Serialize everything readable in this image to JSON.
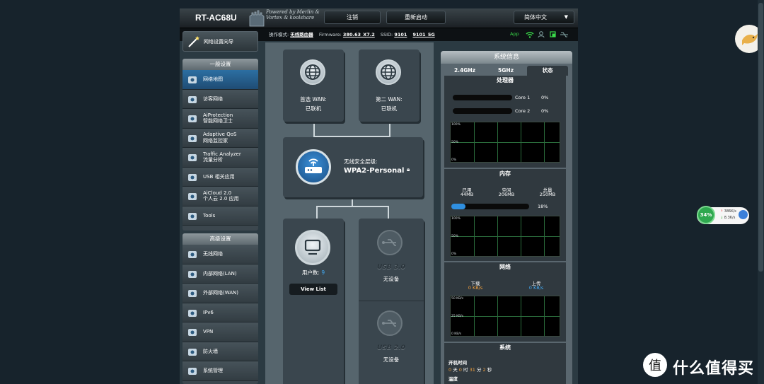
{
  "header": {
    "model": "RT-AC68U",
    "logo_text": "Powered by Merlin & Vortex & koolshare",
    "logout": "注销",
    "reboot": "重新启动",
    "language": "简体中文"
  },
  "status_line": {
    "mode_label": "操作模式:",
    "mode_value": "无线路由器",
    "fw_label": "Firmware:",
    "fw_value": "380.63_X7.2",
    "ssid_label": "SSID:",
    "ssid1": "9101",
    "ssid2": "9101_5G",
    "app": "App"
  },
  "sidebar": {
    "qis": "网络设置向导",
    "general_head": "一般设置",
    "general": [
      {
        "label": "网络地图",
        "icon": "network-map-icon"
      },
      {
        "label": "访客网络",
        "icon": "guest-network-icon"
      },
      {
        "label": "AiProtection",
        "sub": "智能网络卫士",
        "icon": "lock-icon"
      },
      {
        "label": "Adaptive QoS",
        "sub": "网络监控家",
        "icon": "gauge-icon"
      },
      {
        "label": "Traffic Analyzer",
        "sub": "流量分析",
        "icon": "chart-icon"
      },
      {
        "label": "USB 相关应用",
        "icon": "puzzle-icon"
      },
      {
        "label": "AiCloud 2.0",
        "sub": "个人云 2.0 应用",
        "icon": "cloud-icon"
      },
      {
        "label": "Tools",
        "icon": "wrench-icon"
      }
    ],
    "advanced_head": "高级设置",
    "advanced": [
      {
        "label": "无线网络",
        "icon": "wifi-icon"
      },
      {
        "label": "内部网络(LAN)",
        "icon": "home-icon"
      },
      {
        "label": "外部网络(WAN)",
        "icon": "globe-icon"
      },
      {
        "label": "IPv6",
        "icon": "ipv6-icon"
      },
      {
        "label": "VPN",
        "icon": "vpn-icon"
      },
      {
        "label": "防火墙",
        "icon": "shield-icon"
      },
      {
        "label": "系统管理",
        "icon": "admin-icon"
      }
    ]
  },
  "map": {
    "wan1_label": "首选 WAN:",
    "wan1_status": "已联机",
    "wan2_label": "第二 WAN:",
    "wan2_status": "已联机",
    "security_label": "无线安全层级:",
    "security_value": "WPA2-Personal",
    "clients_label": "用户数:",
    "clients_count": "9",
    "view_list": "View List",
    "usb1": "USB 3.0",
    "usb1_status": "无设备",
    "usb2": "USB 2.0",
    "usb2_status": "无设备"
  },
  "sysinfo": {
    "title": "系统信息",
    "tabs": [
      "2.4GHz",
      "5GHz",
      "状态"
    ],
    "cpu_head": "处理器",
    "cores": [
      {
        "name": "Core 1",
        "value": "0%"
      },
      {
        "name": "Core 2",
        "value": "0%"
      }
    ],
    "graph_ticks": [
      "100%",
      "50%",
      "0%"
    ],
    "mem_head": "内存",
    "mem_labels": [
      "已用",
      "空闲",
      "总量"
    ],
    "mem_values": [
      "44MB",
      "206MB",
      "250MB"
    ],
    "mem_pct": "18%",
    "mem_fraction": 0.18,
    "net_head": "网络",
    "down_label": "下载",
    "down_value": "0 KB/s",
    "up_label": "上传",
    "up_value": "0 KB/s",
    "net_ticks": [
      "50 KB/s",
      "25 KB/s",
      "0 KB/s"
    ],
    "sys_head": "系统",
    "uptime_label": "开机时间",
    "uptime": {
      "d": "0",
      "d_unit": "天",
      "h": "0",
      "h_unit": "时",
      "m": "31",
      "m_unit": "分",
      "s": "2",
      "s_unit": "秒"
    },
    "temp_label": "温度"
  },
  "widget": {
    "percent": "34%",
    "up": "386K/s",
    "down": "8.3K/s"
  },
  "watermark": "什么值得买",
  "colors": {
    "accent": "#2c6fa2",
    "orange": "#f2a03d",
    "blue": "#42a8f0",
    "grid": "#2a6b3b"
  }
}
